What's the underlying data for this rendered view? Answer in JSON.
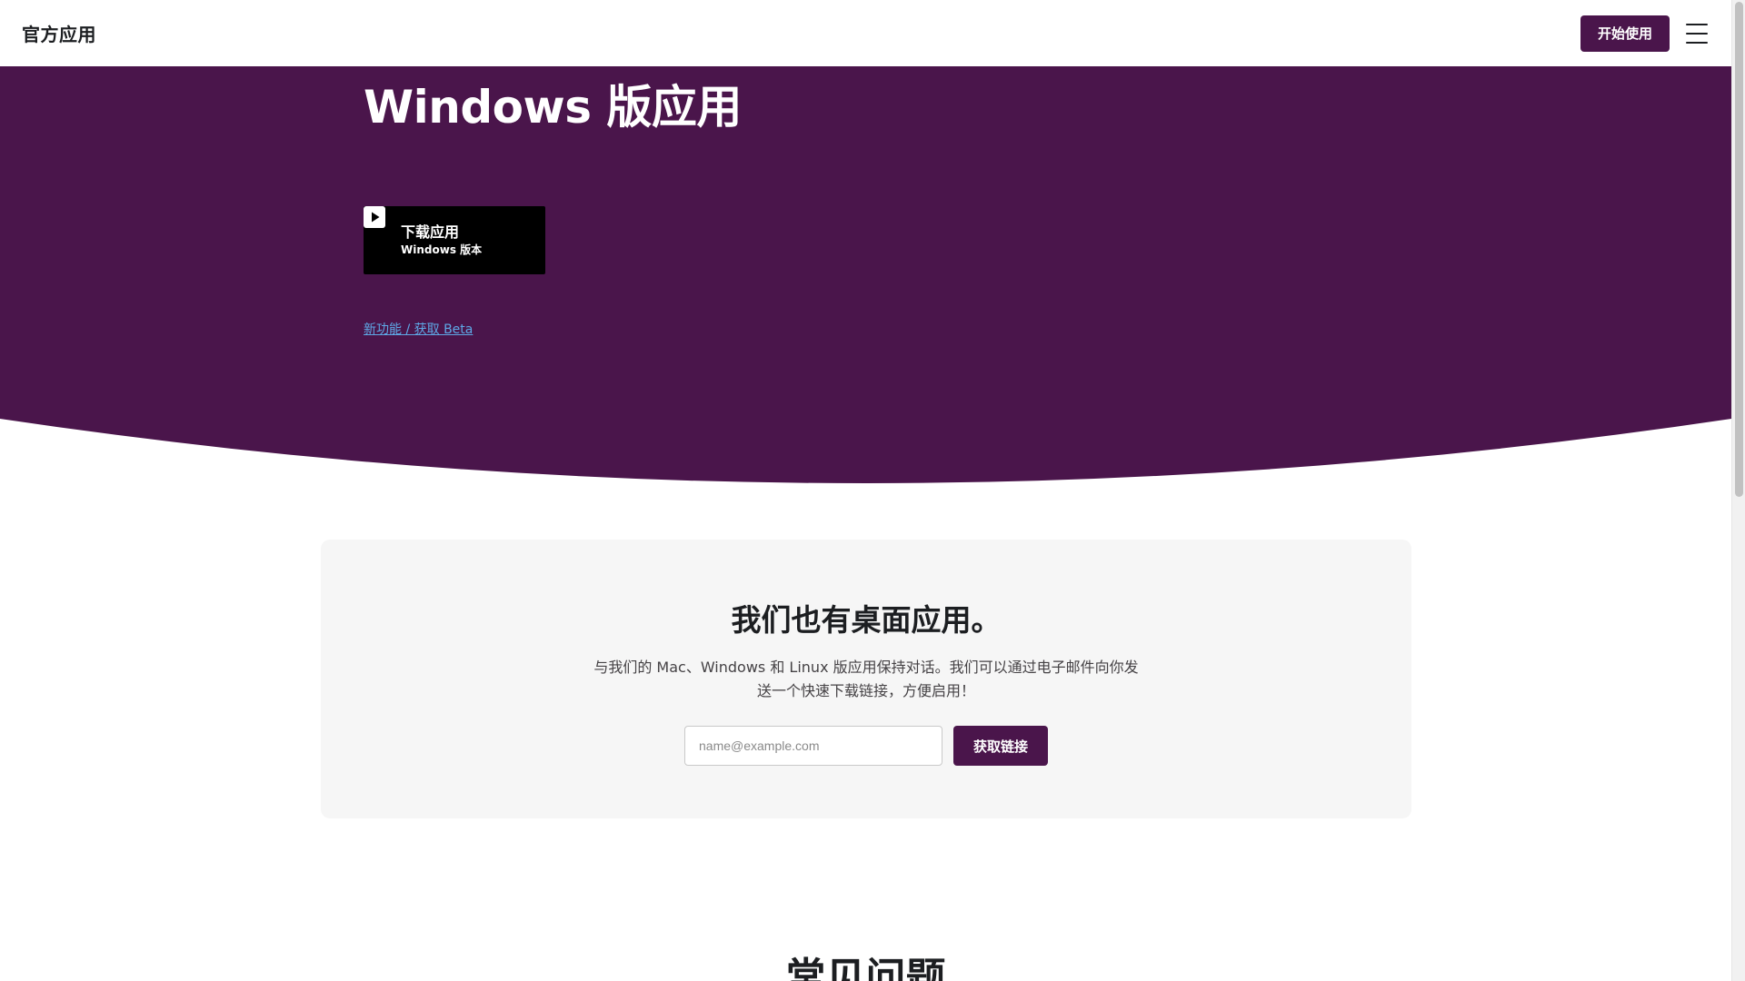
{
  "header": {
    "logo": "官方应用",
    "cta_label": "开始使用",
    "menu_icon": "hamburger-icon"
  },
  "hero": {
    "title": "Windows 版应用",
    "download": {
      "label": "下载应用",
      "sublabel": "Windows 版本",
      "icon": "play-icon"
    },
    "beta_link": "新功能 / 获取 Beta"
  },
  "desktop_card": {
    "title": "我们也有桌面应用。",
    "description": "与我们的 Mac、Windows 和 Linux 版应用保持对话。我们可以通过电子邮件向你发送一个快速下载链接，方便启用！",
    "email_placeholder": "name@example.com",
    "email_value": "",
    "submit_label": "获取链接"
  },
  "faq": {
    "heading": "常见问题"
  },
  "colors": {
    "brand": "#4a154b",
    "link": "#5ea8e6",
    "card_bg": "#f6f6f6",
    "download_bg": "#000000"
  }
}
